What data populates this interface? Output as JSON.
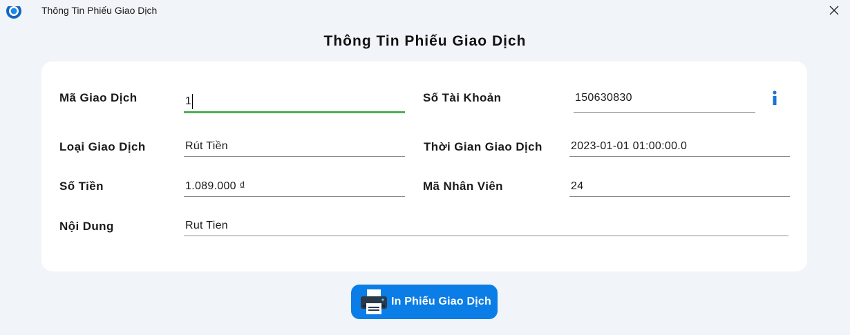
{
  "window": {
    "title": "Thông Tin Phiếu Giao Dịch"
  },
  "page": {
    "heading": "Thông Tin Phiếu Giao Dịch"
  },
  "form": {
    "ma_giao_dich": {
      "label": "Mã Giao Dịch",
      "value": "1"
    },
    "so_tai_khoan": {
      "label": "Số Tài Khoản",
      "value": "150630830"
    },
    "loai_giao_dich": {
      "label": "Loại Giao Dịch",
      "value": "Rút Tiền"
    },
    "thoi_gian_giao_dich": {
      "label": "Thời Gian Giao Dịch",
      "value": "2023-01-01 01:00:00.0"
    },
    "so_tien": {
      "label": "Số Tiền",
      "value": "1.089.000 ₫"
    },
    "ma_nhan_vien": {
      "label": "Mã Nhân Viên",
      "value": "24"
    },
    "noi_dung": {
      "label": "Nội Dung",
      "value": "Rut Tien"
    }
  },
  "actions": {
    "print_label": "In Phiếu Giao Dịch"
  },
  "icons": {
    "app": "app-logo-icon",
    "close": "close-icon",
    "info": "info-icon",
    "print": "printer-icon"
  },
  "colors": {
    "accent": "#0a7de6",
    "focus_underline": "#4caf50",
    "info": "#1976d2"
  }
}
